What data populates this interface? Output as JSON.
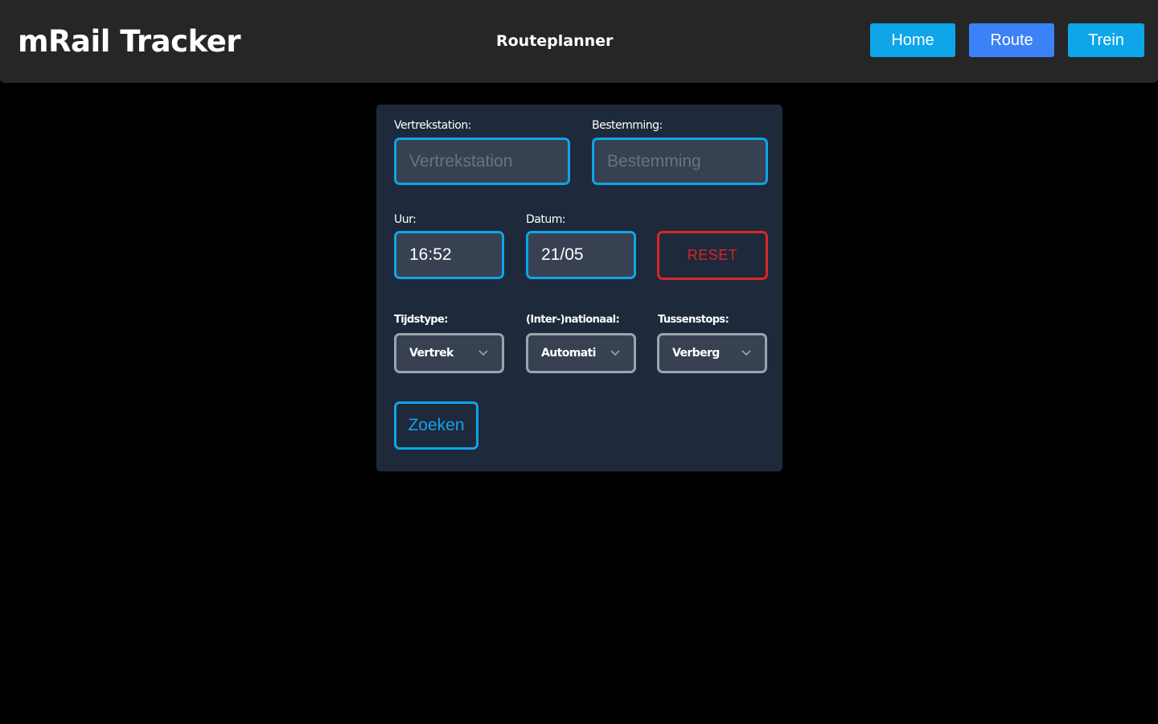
{
  "header": {
    "app_title": "mRail Tracker",
    "page_heading": "Routeplanner",
    "nav": {
      "home_label": "Home",
      "route_label": "Route",
      "trein_label": "Trein"
    }
  },
  "colors": {
    "header_bg": "#262626",
    "card_bg": "#1e293b",
    "accent": "#0ea5e9",
    "route_btn": "#3b82f6",
    "danger": "#dc2626"
  },
  "form": {
    "departure": {
      "label": "Vertrekstation:",
      "placeholder": "Vertrekstation",
      "value": ""
    },
    "destination": {
      "label": "Bestemming:",
      "placeholder": "Bestemming",
      "value": ""
    },
    "time": {
      "label": "Uur:",
      "value": "16:52"
    },
    "date": {
      "label": "Datum:",
      "value": "21/05"
    },
    "reset_label": "RESET",
    "time_type": {
      "label": "Tijdstype:",
      "selected": "Vertrek",
      "icon": "chevron-down-icon"
    },
    "scope": {
      "label": "(Inter-)nationaal:",
      "selected": "Automati",
      "icon": "chevron-down-icon"
    },
    "stops": {
      "label": "Tussenstops:",
      "selected": "Verberg",
      "icon": "chevron-down-icon"
    },
    "search_label": "Zoeken"
  }
}
